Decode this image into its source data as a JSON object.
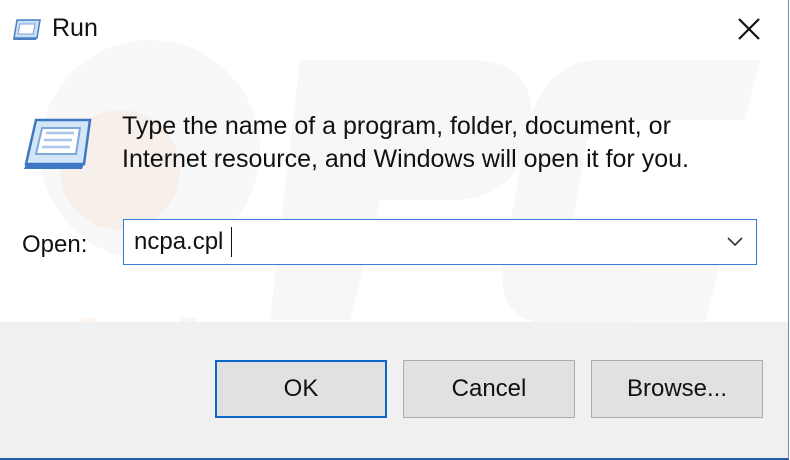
{
  "window": {
    "title": "Run",
    "title_icon": "run-icon",
    "close_icon": "close-icon"
  },
  "body": {
    "icon": "run-icon",
    "instructions": "Type the name of a program, folder, document, or Internet resource, and Windows will open it for you.",
    "open_label": "Open:",
    "open_value": "ncpa.cpl",
    "dropdown_icon": "chevron-down-icon"
  },
  "buttons": {
    "ok": "OK",
    "cancel": "Cancel",
    "browse": "Browse..."
  },
  "colors": {
    "focus_border": "#3b7bd6",
    "default_button_border": "#0b66c6",
    "footer_bg": "#f0f0f0",
    "button_bg": "#e1e1e1"
  }
}
